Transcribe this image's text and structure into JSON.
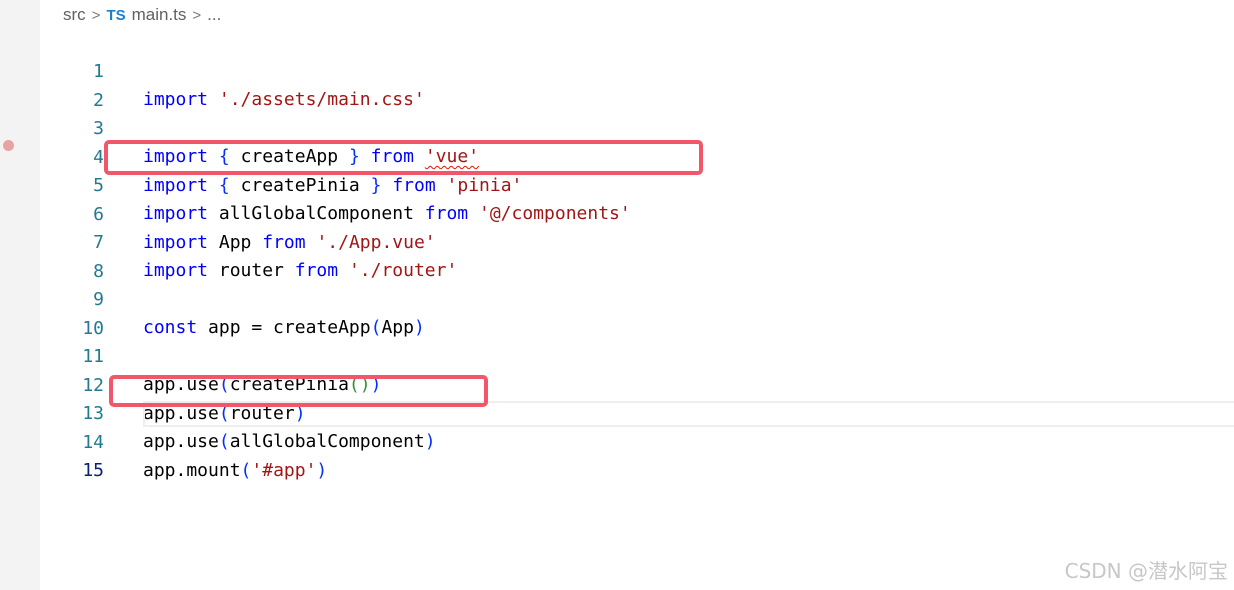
{
  "breadcrumb": {
    "folder": "src",
    "file_icon": "TS",
    "file": "main.ts",
    "more": "..."
  },
  "editor": {
    "line_numbers": [
      "1",
      "2",
      "3",
      "4",
      "5",
      "6",
      "7",
      "8",
      "9",
      "10",
      "11",
      "12",
      "13",
      "14",
      "15"
    ],
    "current_line": "15",
    "code": {
      "l1": {
        "kw": "import",
        "str": "'./assets/main.css'"
      },
      "l3": {
        "kw1": "import",
        "open": "{",
        "name": "createApp",
        "close": "}",
        "kw2": "from",
        "str": "'vue'"
      },
      "l4": {
        "kw1": "import",
        "open": "{",
        "name": "createPinia",
        "close": "}",
        "kw2": "from",
        "str": "'pinia'"
      },
      "l5": {
        "kw1": "import",
        "name": "allGlobalComponent",
        "kw2": "from",
        "str": "'@/components'"
      },
      "l6": {
        "kw1": "import",
        "name": "App",
        "kw2": "from",
        "str": "'./App.vue'"
      },
      "l7": {
        "kw1": "import",
        "name": "router",
        "kw2": "from",
        "str": "'./router'"
      },
      "l9": {
        "kw": "const",
        "rest": "app = createApp",
        "open": "(",
        "arg": "App",
        "close": ")"
      },
      "l11": {
        "obj": "app.use",
        "open": "(",
        "fn": "createPinia",
        "inner": "()",
        "close": ")"
      },
      "l12": {
        "obj": "app.use",
        "open": "(",
        "arg": "router",
        "close": ")"
      },
      "l13": {
        "obj": "app.use",
        "open": "(",
        "arg": "allGlobalComponent",
        "close": ")"
      },
      "l14": {
        "obj": "app.mount",
        "open": "(",
        "str": "'#app'",
        "close": ")"
      }
    }
  },
  "annotations": {
    "highlight_color": "#f2566a",
    "highlighted_lines": [
      "5",
      "13"
    ]
  },
  "watermark": "CSDN @潜水阿宝"
}
